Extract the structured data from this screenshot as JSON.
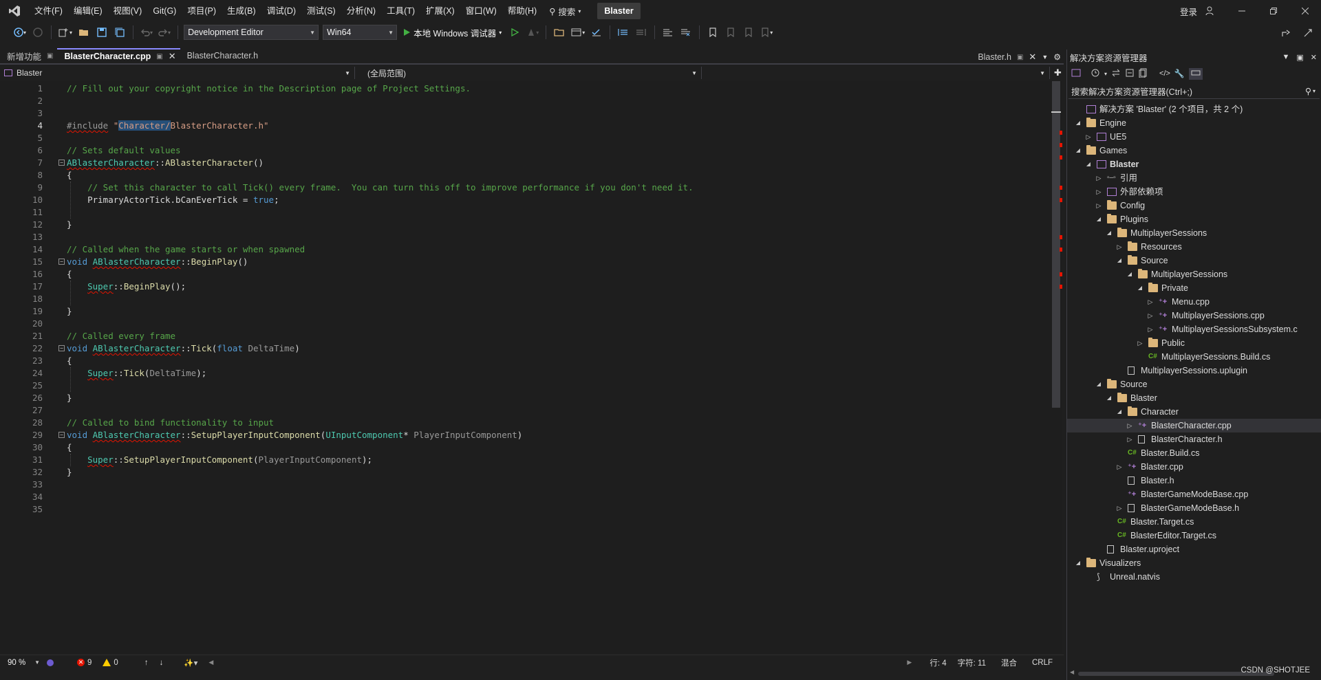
{
  "menu": {
    "items": [
      "文件(F)",
      "编辑(E)",
      "视图(V)",
      "Git(G)",
      "项目(P)",
      "生成(B)",
      "调试(D)",
      "测试(S)",
      "分析(N)",
      "工具(T)",
      "扩展(X)",
      "窗口(W)",
      "帮助(H)"
    ],
    "search": "搜索",
    "solution_name": "Blaster",
    "login": "登录"
  },
  "toolbar": {
    "configuration": "Development Editor",
    "platform": "Win64",
    "run_label": "本地 Windows 调试器"
  },
  "tabs": {
    "left": [
      {
        "label": "新增功能",
        "active": false
      },
      {
        "label": "BlasterCharacter.cpp",
        "active": true
      },
      {
        "label": "BlasterCharacter.h",
        "active": false
      }
    ],
    "right": "Blaster.h"
  },
  "navbar": {
    "project": "Blaster",
    "scope": "(全局范围)",
    "member": ""
  },
  "editor": {
    "current_line": 4,
    "lines": [
      "// Fill out your copyright notice in the Description page of Project Settings.",
      "",
      "",
      "#include \"Character/BlasterCharacter.h\"",
      "",
      "// Sets default values",
      "ABlasterCharacter::ABlasterCharacter()",
      "{",
      "    // Set this character to call Tick() every frame.  You can turn this off to improve performance if you don't need it.",
      "    PrimaryActorTick.bCanEverTick = true;",
      "",
      "}",
      "",
      "// Called when the game starts or when spawned",
      "void ABlasterCharacter::BeginPlay()",
      "{",
      "    Super::BeginPlay();",
      "",
      "}",
      "",
      "// Called every frame",
      "void ABlasterCharacter::Tick(float DeltaTime)",
      "{",
      "    Super::Tick(DeltaTime);",
      "",
      "}",
      "",
      "// Called to bind functionality to input",
      "void ABlasterCharacter::SetupPlayerInputComponent(UInputComponent* PlayerInputComponent)",
      "{",
      "    Super::SetupPlayerInputComponent(PlayerInputComponent);",
      "}",
      "",
      "",
      ""
    ]
  },
  "status": {
    "zoom": "90 %",
    "errors": "9",
    "warnings": "0",
    "line": "行: 4",
    "char": "字符: 11",
    "mix": "混合",
    "eol": "CRLF"
  },
  "solution_explorer": {
    "title": "解决方案资源管理器",
    "search_placeholder": "搜索解决方案资源管理器(Ctrl+;)",
    "tree": [
      {
        "label": "解决方案 'Blaster' (2 个项目，共 2 个)",
        "depth": 0,
        "icon": "solution-icon",
        "expander": "none"
      },
      {
        "label": "Engine",
        "depth": 0,
        "icon": "folder-icon",
        "expander": "open"
      },
      {
        "label": "UE5",
        "depth": 1,
        "icon": "project-icon",
        "expander": "closed"
      },
      {
        "label": "Games",
        "depth": 0,
        "icon": "folder-icon",
        "expander": "open"
      },
      {
        "label": "Blaster",
        "depth": 1,
        "icon": "project-icon",
        "expander": "open",
        "bold": true
      },
      {
        "label": "引用",
        "depth": 2,
        "icon": "references-icon",
        "expander": "closed"
      },
      {
        "label": "外部依赖项",
        "depth": 2,
        "icon": "external-deps-icon",
        "expander": "closed"
      },
      {
        "label": "Config",
        "depth": 2,
        "icon": "folder-icon",
        "expander": "closed"
      },
      {
        "label": "Plugins",
        "depth": 2,
        "icon": "folder-icon",
        "expander": "open"
      },
      {
        "label": "MultiplayerSessions",
        "depth": 3,
        "icon": "folder-icon",
        "expander": "open"
      },
      {
        "label": "Resources",
        "depth": 4,
        "icon": "folder-icon",
        "expander": "closed"
      },
      {
        "label": "Source",
        "depth": 4,
        "icon": "folder-icon",
        "expander": "open"
      },
      {
        "label": "MultiplayerSessions",
        "depth": 5,
        "icon": "folder-icon",
        "expander": "open"
      },
      {
        "label": "Private",
        "depth": 6,
        "icon": "folder-icon",
        "expander": "open"
      },
      {
        "label": "Menu.cpp",
        "depth": 7,
        "icon": "cpp-icon",
        "expander": "closed"
      },
      {
        "label": "MultiplayerSessions.cpp",
        "depth": 7,
        "icon": "cpp-icon",
        "expander": "closed"
      },
      {
        "label": "MultiplayerSessionsSubsystem.c",
        "depth": 7,
        "icon": "cpp-icon",
        "expander": "closed"
      },
      {
        "label": "Public",
        "depth": 6,
        "icon": "folder-icon",
        "expander": "closed"
      },
      {
        "label": "MultiplayerSessions.Build.cs",
        "depth": 6,
        "icon": "cs-icon",
        "expander": "none"
      },
      {
        "label": "MultiplayerSessions.uplugin",
        "depth": 4,
        "icon": "file-icon",
        "expander": "none"
      },
      {
        "label": "Source",
        "depth": 2,
        "icon": "folder-icon",
        "expander": "open"
      },
      {
        "label": "Blaster",
        "depth": 3,
        "icon": "folder-icon",
        "expander": "open"
      },
      {
        "label": "Character",
        "depth": 4,
        "icon": "folder-icon",
        "expander": "open"
      },
      {
        "label": "BlasterCharacter.cpp",
        "depth": 5,
        "icon": "cpp-icon",
        "expander": "closed",
        "selected": true
      },
      {
        "label": "BlasterCharacter.h",
        "depth": 5,
        "icon": "header-icon",
        "expander": "closed"
      },
      {
        "label": "Blaster.Build.cs",
        "depth": 4,
        "icon": "cs-icon",
        "expander": "none"
      },
      {
        "label": "Blaster.cpp",
        "depth": 4,
        "icon": "cpp-icon",
        "expander": "closed"
      },
      {
        "label": "Blaster.h",
        "depth": 4,
        "icon": "header-icon",
        "expander": "none"
      },
      {
        "label": "BlasterGameModeBase.cpp",
        "depth": 4,
        "icon": "cpp-icon",
        "expander": "none"
      },
      {
        "label": "BlasterGameModeBase.h",
        "depth": 4,
        "icon": "header-icon",
        "expander": "closed"
      },
      {
        "label": "Blaster.Target.cs",
        "depth": 3,
        "icon": "cs-icon",
        "expander": "none"
      },
      {
        "label": "BlasterEditor.Target.cs",
        "depth": 3,
        "icon": "cs-icon",
        "expander": "none"
      },
      {
        "label": "Blaster.uproject",
        "depth": 2,
        "icon": "file-icon",
        "expander": "none"
      },
      {
        "label": "Visualizers",
        "depth": 0,
        "icon": "folder-icon",
        "expander": "open"
      },
      {
        "label": "Unreal.natvis",
        "depth": 1,
        "icon": "natvis-icon",
        "expander": "none"
      }
    ]
  },
  "watermark": "CSDN @SHOTJEE"
}
